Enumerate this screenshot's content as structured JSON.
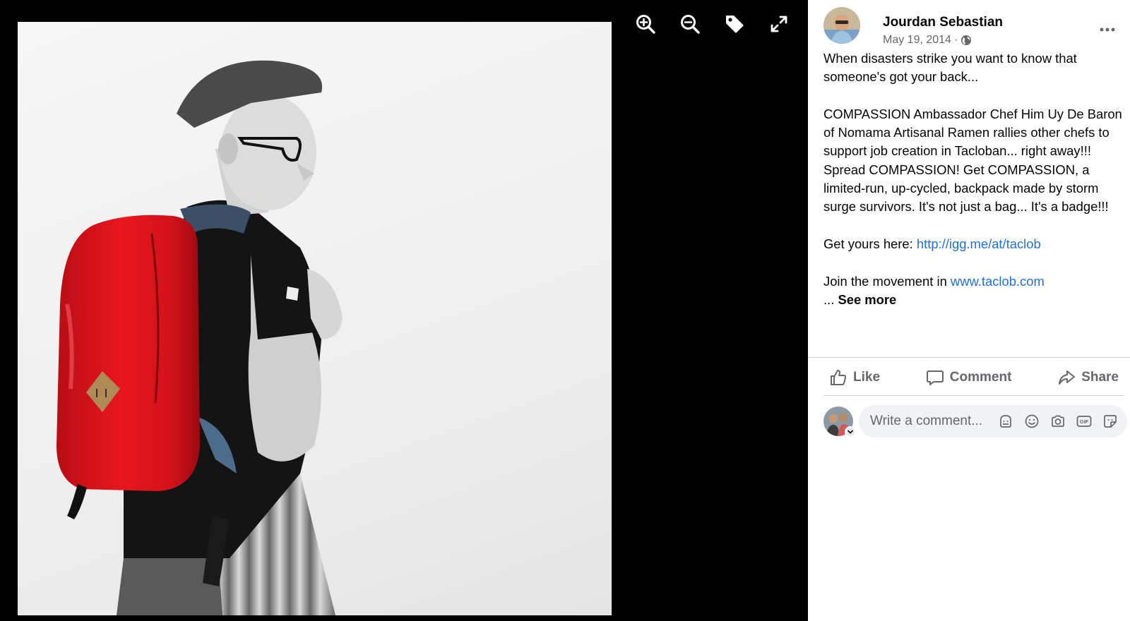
{
  "viewer": {
    "tools": [
      {
        "icon": "zoom-in-icon"
      },
      {
        "icon": "zoom-out-icon"
      },
      {
        "icon": "tag-icon"
      },
      {
        "icon": "fullscreen-icon"
      }
    ]
  },
  "post": {
    "author": "Jourdan Sebastian",
    "date": "May 19, 2014",
    "separator": "·",
    "audience_icon": "globe-icon",
    "more_icon": "more-options-icon",
    "paragraph1": "When disasters strike you want to know that someone's got your back...",
    "paragraph2": "COMPASSION Ambassador Chef Him Uy De Baron of Nomama Artisanal Ramen rallies other chefs to support job creation in Tacloban... right away!!! Spread COMPASSION! Get COMPASSION, a limited-run, up-cycled, backpack made by storm surge survivors. It's not just a bag... It's a badge!!!",
    "get_yours_prefix": "Get yours here: ",
    "get_yours_link": "http://igg.me/at/taclob",
    "join_prefix": "Join the movement in ",
    "join_link": "www.taclob.com",
    "ellipsis": "... ",
    "see_more": "See more"
  },
  "actions": {
    "like": "Like",
    "comment": "Comment",
    "share": "Share"
  },
  "comment_box": {
    "placeholder": "Write a comment...",
    "icons": [
      "avatar-sticker-icon",
      "emoji-icon",
      "camera-icon",
      "gif-icon",
      "sticker-icon"
    ]
  },
  "colors": {
    "link": "#216fdb",
    "backpack": "#e0141c",
    "viewer_bg": "#000000"
  }
}
